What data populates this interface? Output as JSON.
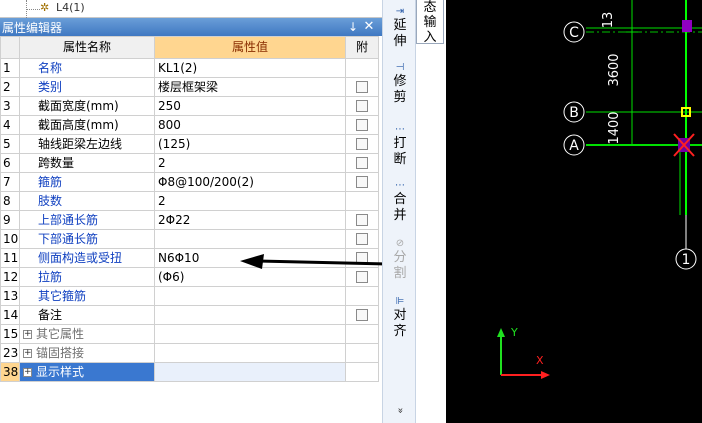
{
  "tree": {
    "partial_item": "L4(1)"
  },
  "panel": {
    "title": "属性编辑器",
    "pin_glyph": "ᴘ",
    "close_glyph": "✕"
  },
  "columns": {
    "index": "",
    "name": "属性名称",
    "value": "属性值",
    "attach": "附"
  },
  "rows": [
    {
      "num": "1",
      "name": "名称",
      "value": "KL1(2)",
      "style": "blue",
      "checkbox": false
    },
    {
      "num": "2",
      "name": "类别",
      "value": "楼层框架梁",
      "style": "blue",
      "checkbox": true
    },
    {
      "num": "3",
      "name": "截面宽度(mm)",
      "value": "250",
      "style": "black",
      "checkbox": true
    },
    {
      "num": "4",
      "name": "截面高度(mm)",
      "value": "800",
      "style": "black",
      "checkbox": true
    },
    {
      "num": "5",
      "name": "轴线距梁左边线",
      "value": "(125)",
      "style": "black",
      "checkbox": true
    },
    {
      "num": "6",
      "name": "跨数量",
      "value": "2",
      "style": "black",
      "checkbox": true
    },
    {
      "num": "7",
      "name": "箍筋",
      "value": "Φ8@100/200(2)",
      "style": "blue",
      "checkbox": true
    },
    {
      "num": "8",
      "name": "肢数",
      "value": "2",
      "style": "blue",
      "checkbox": false
    },
    {
      "num": "9",
      "name": "上部通长筋",
      "value": "2Φ22",
      "style": "blue",
      "checkbox": true
    },
    {
      "num": "10",
      "name": "下部通长筋",
      "value": "",
      "style": "blue",
      "checkbox": true
    },
    {
      "num": "11",
      "name": "侧面构造或受扭",
      "value": "N6Φ10",
      "style": "blue",
      "checkbox": true
    },
    {
      "num": "12",
      "name": "拉筋",
      "value": "(Φ6)",
      "style": "blue",
      "checkbox": true
    },
    {
      "num": "13",
      "name": "其它箍筋",
      "value": "",
      "style": "blue",
      "checkbox": false
    },
    {
      "num": "14",
      "name": "备注",
      "value": "",
      "style": "black",
      "checkbox": true
    },
    {
      "num": "15",
      "name": "其它属性",
      "value": "",
      "style": "group",
      "checkbox": false
    },
    {
      "num": "23",
      "name": "锚固搭接",
      "value": "",
      "style": "group",
      "checkbox": false
    },
    {
      "num": "38",
      "name": "显示样式",
      "value": "",
      "style": "selected",
      "checkbox": false
    }
  ],
  "expander_glyph": "+",
  "toolbar": {
    "items": [
      {
        "name": "extend",
        "label_1": "延",
        "label_2": "伸",
        "icon": "extend-icon",
        "disabled": false
      },
      {
        "name": "trim",
        "label_1": "修",
        "label_2": "剪",
        "icon": "trim-icon",
        "disabled": false
      },
      {
        "name": "break",
        "label_1": "打",
        "label_2": "断",
        "icon": "break-icon",
        "disabled": false
      },
      {
        "name": "merge",
        "label_1": "合",
        "label_2": "并",
        "icon": "merge-icon",
        "disabled": false
      },
      {
        "name": "split",
        "label_1": "分",
        "label_2": "割",
        "icon": "split-icon",
        "disabled": true
      },
      {
        "name": "align",
        "label_1": "对",
        "label_2": "齐",
        "icon": "align-icon",
        "disabled": false
      }
    ],
    "more_glyph": "»"
  },
  "state_tab": {
    "label_1": "态",
    "label_2": "输",
    "label_3": "入"
  },
  "canvas": {
    "axis_labels": [
      "C",
      "B",
      "A",
      "1"
    ],
    "dimensions": [
      "13",
      "3600",
      "1400"
    ],
    "ucs": {
      "x": "X",
      "y": "Y"
    },
    "colors": {
      "axis_line": "#00e000",
      "bubble": "#ffffff",
      "beam": "#00ff00",
      "ucs_x": "#ff2020",
      "ucs_y": "#20e020",
      "marker": "#9000c0",
      "node": "#ffff00"
    }
  }
}
